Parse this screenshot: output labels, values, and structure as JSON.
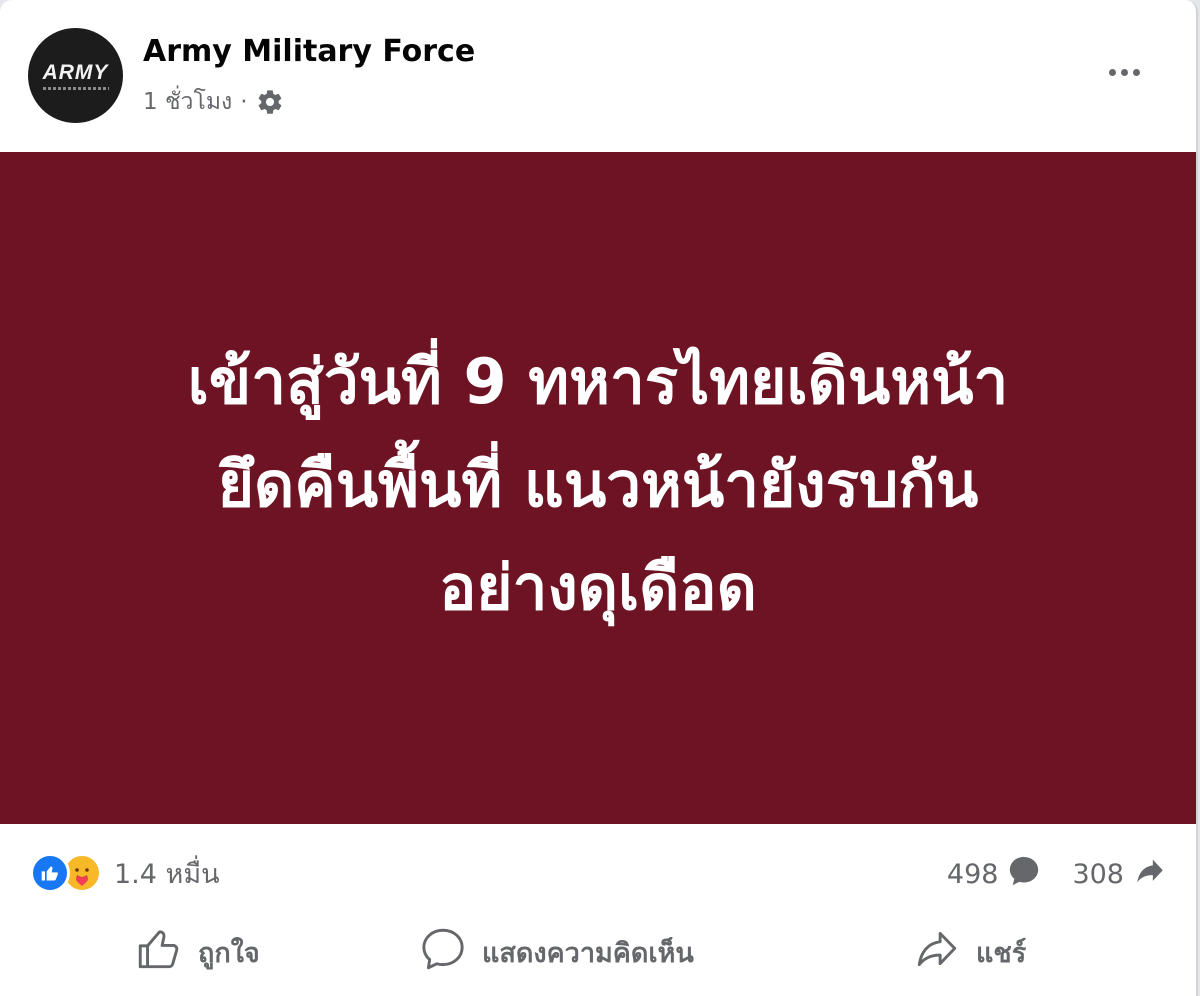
{
  "post": {
    "page_name": "Army Military Force",
    "time": "1 ชั่วโมง",
    "separator": "·",
    "privacy_icon": "gear-icon",
    "avatar": {
      "logo_text": "ARMY"
    },
    "image_text": [
      "เข้าสู่วันที่ 9 ทหารไทยเดินหน้า",
      "ยึดคืนพื้นที่ แนวหน้ายังรบกัน",
      "อย่างดุเดือด"
    ],
    "image_background": "#6d1324"
  },
  "stats": {
    "reaction_icons": [
      "like-reaction-icon",
      "care-reaction-icon"
    ],
    "reaction_count": "1.4 หมื่น",
    "comment_count": "498",
    "share_count": "308"
  },
  "actions": {
    "like_label": "ถูกใจ",
    "comment_label": "แสดงความคิดเห็น",
    "share_label": "แชร์"
  },
  "colors": {
    "brand_blue": "#1877f2",
    "secondary_text": "#65676b",
    "care_yellow": "#f7b928"
  }
}
